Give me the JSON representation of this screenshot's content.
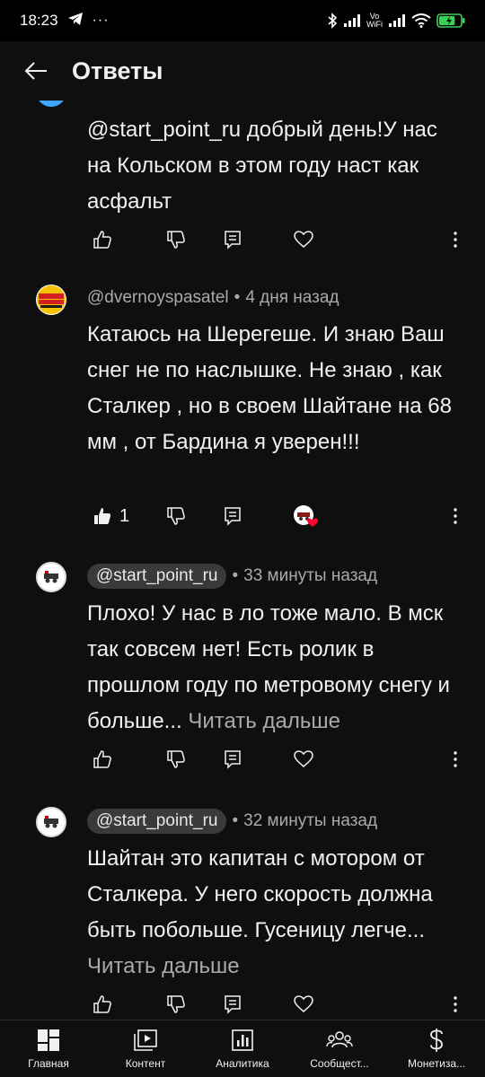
{
  "status_bar": {
    "time": "18:23",
    "vowifi_label_top": "Vo",
    "vowifi_label_bottom": "WiFi",
    "battery_level": 0.75
  },
  "header": {
    "title": "Ответы"
  },
  "comments": [
    {
      "author": "",
      "time": "",
      "text": "@start_point_ru добрый день!У нас на Кольском в этом году наст как асфальт",
      "likes": "",
      "liked": false,
      "hearted": false
    },
    {
      "author": "@dvernoyspasatel",
      "time": "4 дня назад",
      "text": "Катаюсь на Шерегеше. И знаю Ваш снег не по наслышке. Не знаю , как Сталкер , но в своем Шайтане на 68 мм , от Бардина я уверен!!!",
      "likes": "1",
      "liked": true,
      "hearted": true
    },
    {
      "author": "@start_point_ru",
      "time": "33 минуты назад",
      "text": "Плохо! У нас в ло тоже мало. В мск так совсем нет! Есть ролик в прошлом году по метровому снегу и больше...",
      "read_more": "Читать дальше",
      "likes": "",
      "liked": false,
      "hearted": false
    },
    {
      "author": "@start_point_ru",
      "time": "32 минуты назад",
      "text": "Шайтан это капитан с мотором от Сталкера. У него скорость должна быть побольше. Гусеницу легче...",
      "read_more": "Читать дальше",
      "likes": "",
      "liked": false,
      "hearted": false
    }
  ],
  "bottom_nav": [
    {
      "label": "Главная",
      "icon": "dashboard-icon"
    },
    {
      "label": "Контент",
      "icon": "content-icon"
    },
    {
      "label": "Аналитика",
      "icon": "analytics-icon"
    },
    {
      "label": "Сообщест...",
      "icon": "community-icon"
    },
    {
      "label": "Монетиза...",
      "icon": "monetization-icon"
    }
  ],
  "colors": {
    "background": "#0f0f0f",
    "text": "#f1f1f1",
    "secondary_text": "#aaaaaa",
    "chip": "#3a3a3a",
    "heart": "#ff0033"
  }
}
